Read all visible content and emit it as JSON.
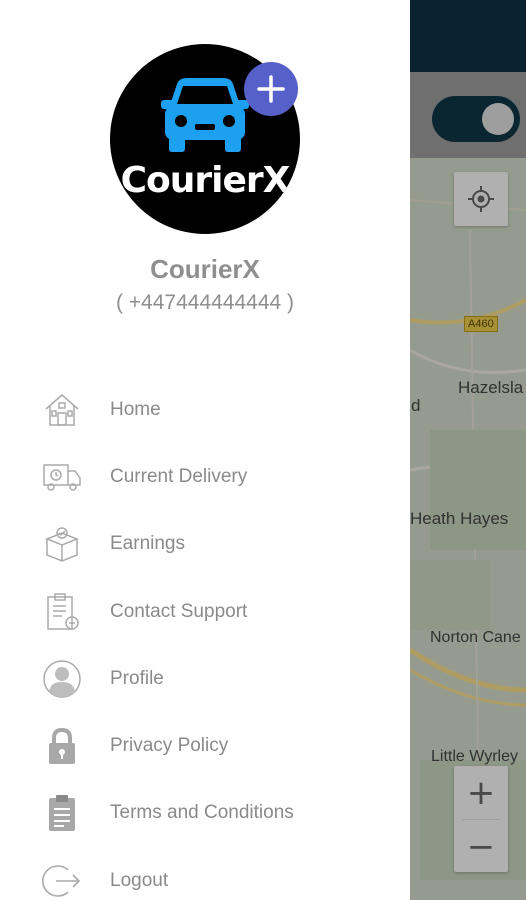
{
  "map": {
    "labels": {
      "hazelslade": "Hazelsla",
      "d_fragment": "d",
      "heath_hayes": "Heath Hayes",
      "norton_canes": "Norton Cane",
      "little_wyrley": "Little Wyrley"
    },
    "road_badge": "A460",
    "zoom_in_label": "+",
    "zoom_out_label": "−",
    "topbar_color": "#0d3343",
    "toggle_state": "on"
  },
  "drawer": {
    "profile": {
      "logo_text": "CourierX",
      "name": "CourierX",
      "phone": "( +447444444444 )",
      "add_badge_icon": "plus-icon"
    },
    "menu": [
      {
        "label": "Home",
        "icon": "home-icon"
      },
      {
        "label": "Current Delivery",
        "icon": "delivery-truck-icon"
      },
      {
        "label": "Earnings",
        "icon": "box-icon"
      },
      {
        "label": "Contact Support",
        "icon": "support-clipboard-icon"
      },
      {
        "label": "Profile",
        "icon": "profile-icon"
      },
      {
        "label": "Privacy Policy",
        "icon": "lock-icon"
      },
      {
        "label": "Terms and Conditions",
        "icon": "clipboard-icon"
      },
      {
        "label": "Logout",
        "icon": "logout-icon"
      }
    ]
  },
  "colors": {
    "accent": "#5560c8",
    "car_blue": "#1ea0f0",
    "text_gray": "#8f8f8f"
  }
}
